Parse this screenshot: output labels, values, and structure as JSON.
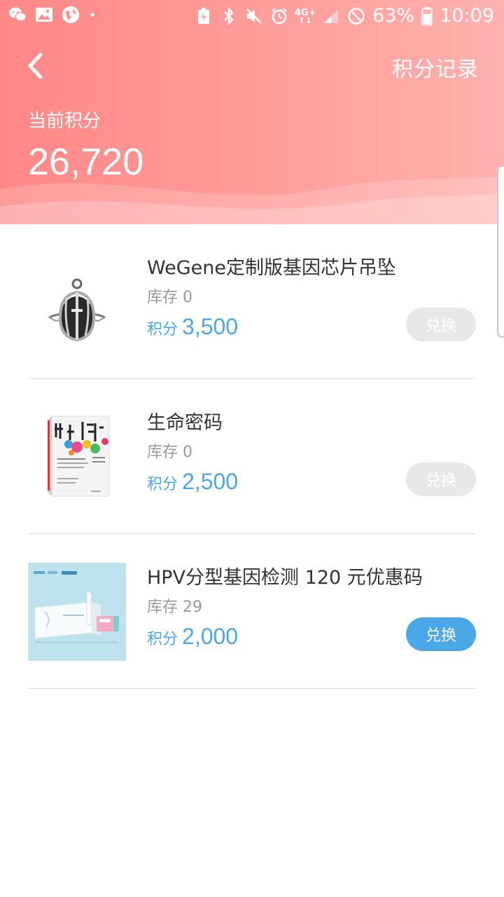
{
  "status_bar": {
    "battery": "63%",
    "time": "10:09",
    "network": "4G+",
    "left_icons": [
      "wechat-icon",
      "image-icon",
      "globe-icon",
      "dot-icon"
    ],
    "right_icons": [
      "battery-saver-icon",
      "bluetooth-icon",
      "mute-icon",
      "alarm-icon",
      "signal-icon",
      "dnd-icon",
      "battery-icon"
    ]
  },
  "header": {
    "back_icon": "chevron-left-icon",
    "record_label": "积分记录",
    "points_label": "当前积分",
    "points_value": "26,720"
  },
  "colors": {
    "header_gradient_start": "#ff8787",
    "header_gradient_end": "#ffb2ae",
    "accent_blue": "#4aa8e8",
    "disabled_button": "#e8e8e8"
  },
  "items": [
    {
      "title": "WeGene定制版基因芯片吊坠",
      "stock": "库存 0",
      "price_label": "积分",
      "price_value": "3,500",
      "button_label": "兑换",
      "button_enabled": false,
      "thumb_icon": "pendant-image"
    },
    {
      "title": "生命密码",
      "stock": "库存 0",
      "price_label": "积分",
      "price_value": "2,500",
      "button_label": "兑换",
      "button_enabled": false,
      "thumb_icon": "book-image"
    },
    {
      "title": "HPV分型基因检测 120 元优惠码",
      "stock": "库存 29",
      "price_label": "积分",
      "price_value": "2,000",
      "button_label": "兑换",
      "button_enabled": true,
      "thumb_icon": "hpv-kit-image"
    }
  ]
}
